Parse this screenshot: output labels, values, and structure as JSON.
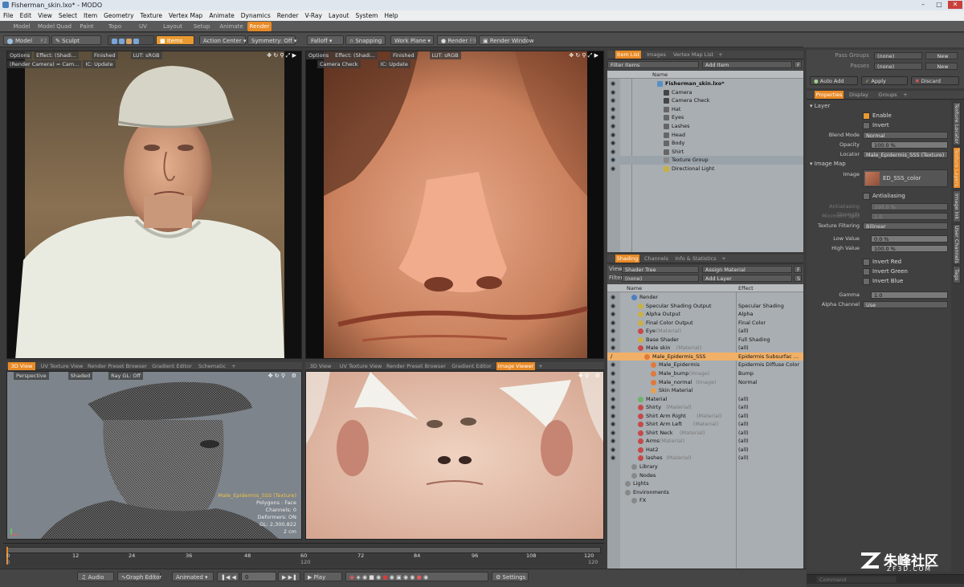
{
  "window": {
    "title": "Fisherman_skin.lxo* - MODO"
  },
  "menu": [
    "File",
    "Edit",
    "View",
    "Select",
    "Item",
    "Geometry",
    "Texture",
    "Vertex Map",
    "Animate",
    "Dynamics",
    "Render",
    "V-Ray",
    "Layout",
    "System",
    "Help"
  ],
  "modes": [
    "Model",
    "Model Quad",
    "Paint",
    "Topo",
    "UV",
    "Layout",
    "Setup",
    "Animate",
    "Render"
  ],
  "toolbar": {
    "model": "Model",
    "f2": "F2",
    "sculpt": "Sculpt",
    "items": "Items",
    "action_center": "Action Center",
    "symmetry": "Symmetry: Off",
    "falloff": "Falloff",
    "snapping": "Snapping",
    "work_plane": "Work Plane",
    "render": "Render",
    "f9": "F9",
    "render_window": "Render Window"
  },
  "pass": {
    "groups_label": "Pass Groups",
    "groups_value": "(none)",
    "passes_label": "Passes",
    "passes_value": "(none)",
    "new": "New",
    "auto_add": "Auto Add",
    "apply": "Apply",
    "discard": "Discard"
  },
  "vp1": {
    "options": "Options",
    "effect": "Effect: (Shadi...",
    "finished": "Finished",
    "lut": "LUT: sRGB",
    "camera": "(Render Camera) = Cam...",
    "ic": "IC: Update"
  },
  "vp2": {
    "options": "Options",
    "effect": "Effect: (Shadi...",
    "finished": "Finished",
    "lut": "LUT: sRGB",
    "camera_check": "Camera Check",
    "ic": "IC: Update"
  },
  "bottom_left_tabs": [
    "3D View",
    "UV Texture View",
    "Render Preset Browser",
    "Gradient Editor",
    "Schematic"
  ],
  "bottom_mid_tabs": [
    "3D View",
    "UV Texture View",
    "Render Preset Browser",
    "Gradient Editor",
    "Image Viewer"
  ],
  "view3d": {
    "perspective": "Perspective",
    "shaded": "Shaded",
    "raygl": "Ray GL: Off",
    "info": [
      "Male_Epidermis_SSS (Texture)",
      "Polygons : Face",
      "Channels: 0",
      "Deformers: ON",
      "GL: 2,300,822",
      "2 cm"
    ]
  },
  "itemlist": {
    "tabs": [
      "Item List",
      "Images",
      "Vertex Map List"
    ],
    "filter": "Filter Items",
    "add_item": "Add Item",
    "col_name": "Name",
    "items": [
      "Fisherman_skin.lxo*",
      "Camera",
      "Camera Check",
      "Hat",
      "Eyes",
      "Lashes",
      "Head",
      "Body",
      "Shirt",
      "Texture Group",
      "Directional Light"
    ]
  },
  "shading": {
    "tabs": [
      "Shading",
      "Channels",
      "Info & Statistics"
    ],
    "view_label": "View",
    "view_value": "Shader Tree",
    "assign": "Assign Material",
    "filter_label": "Filter",
    "filter_value": "(none)",
    "add_layer": "Add Layer",
    "col_name": "Name",
    "col_effect": "Effect",
    "rows": [
      {
        "name": "Render",
        "type": "",
        "effect": ""
      },
      {
        "name": "Specular Shading Output",
        "type": "",
        "effect": "Specular Shading"
      },
      {
        "name": "Alpha Output",
        "type": "",
        "effect": "Alpha"
      },
      {
        "name": "Final Color Output",
        "type": "",
        "effect": "Final Color"
      },
      {
        "name": "Eye",
        "type": "(Material)",
        "effect": "(all)"
      },
      {
        "name": "Base Shader",
        "type": "",
        "effect": "Full Shading"
      },
      {
        "name": "Male skin",
        "type": "(Material)",
        "effect": "(all)"
      },
      {
        "name": "Male_Epidermis_SSS",
        "type": "",
        "effect": "Epidermis Subsurfac ..."
      },
      {
        "name": "Male_Epidermis",
        "type": "",
        "effect": "Epidermis Diffuse Color"
      },
      {
        "name": "Male_bump",
        "type": "(Image)",
        "effect": "Bump"
      },
      {
        "name": "Male_normal",
        "type": "(Image)",
        "effect": "Normal"
      },
      {
        "name": "Skin Material",
        "type": "",
        "effect": ""
      },
      {
        "name": "Material",
        "type": "",
        "effect": "(all)"
      },
      {
        "name": "Shirty",
        "type": "(Material)",
        "effect": "(all)"
      },
      {
        "name": "Shirt Arm Right",
        "type": "(Material)",
        "effect": "(all)"
      },
      {
        "name": "Shirt Arm Left",
        "type": "(Material)",
        "effect": "(all)"
      },
      {
        "name": "Shirt Neck",
        "type": "(Material)",
        "effect": "(all)"
      },
      {
        "name": "Arms",
        "type": "(Material)",
        "effect": "(all)"
      },
      {
        "name": "Hat2",
        "type": "",
        "effect": "(all)"
      },
      {
        "name": "lashes",
        "type": "(Material)",
        "effect": "(all)"
      },
      {
        "name": "Library",
        "type": "",
        "effect": ""
      },
      {
        "name": "Nodes",
        "type": "",
        "effect": ""
      },
      {
        "name": "Lights",
        "type": "",
        "effect": ""
      },
      {
        "name": "Environments",
        "type": "",
        "effect": ""
      },
      {
        "name": "FX",
        "type": "",
        "effect": ""
      }
    ]
  },
  "props": {
    "tabs": [
      "Properties",
      "Display",
      "Groups"
    ],
    "layer": "Layer",
    "enable": "Enable",
    "invert": "Invert",
    "blend_label": "Blend Mode",
    "blend_value": "Normal",
    "opacity_label": "Opacity",
    "opacity_value": "100.0 %",
    "locator_label": "Locator",
    "locator_value": "Male_Epidermis_SSS (Texture)",
    "image_map": "Image Map",
    "image_label": "Image",
    "image_value": "ED_SSS_color",
    "antialiasing": "Antialiasing",
    "aa_strength_label": "Antialiasing Strength",
    "aa_strength_value": "100.0 %",
    "min_spot_label": "Minimum Spot",
    "min_spot_value": "1.0",
    "tex_filter_label": "Texture Filtering",
    "tex_filter_value": "Bilinear",
    "low_label": "Low Value",
    "low_value": "0.0 %",
    "high_label": "High Value",
    "high_value": "100.0 %",
    "invert_red": "Invert Red",
    "invert_green": "Invert Green",
    "invert_blue": "Invert Blue",
    "gamma_label": "Gamma",
    "gamma_value": "1.0",
    "alpha_label": "Alpha Channel",
    "alpha_value": "Use",
    "side_tabs": [
      "Texture Locator",
      "Texture Layers",
      "Image Ink",
      "User Channels",
      "Tags"
    ],
    "command": "Command"
  },
  "timeline": {
    "ticks": [
      "0",
      "12",
      "24",
      "36",
      "48",
      "60",
      "72",
      "84",
      "96",
      "108",
      "120"
    ],
    "sub": [
      "0",
      "120"
    ],
    "end": "120"
  },
  "transport": {
    "audio": "Audio",
    "graph_editor": "Graph Editor",
    "animated": "Animated",
    "frame": "0",
    "play": "Play",
    "settings": "Settings"
  },
  "watermark": {
    "text": "朱峰社区",
    "url": "ZF3D.COM"
  }
}
